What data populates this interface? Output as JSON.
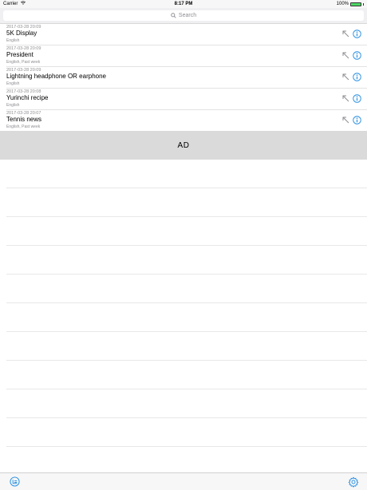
{
  "status": {
    "carrier": "Carrier",
    "time": "8:17 PM",
    "battery": "100%",
    "battery_level": 1.0
  },
  "search": {
    "placeholder": "Search"
  },
  "history": [
    {
      "date": "2017-03-28 20:09",
      "title": "5K Display",
      "sub": "English"
    },
    {
      "date": "2017-03-28 20:09",
      "title": "President",
      "sub": "English, Past week"
    },
    {
      "date": "2017-03-28 20:09",
      "title": "Lightning headphone OR earphone",
      "sub": "English"
    },
    {
      "date": "2017-03-28 20:08",
      "title": "Yurinchi recipe",
      "sub": "English"
    },
    {
      "date": "2017-03-28 20:07",
      "title": "Tennis news",
      "sub": "English, Past week"
    }
  ],
  "ad": {
    "label": "AD"
  },
  "colors": {
    "accent": "#1f8ae0",
    "battery": "#4cd964",
    "ad_background": "#dadada"
  }
}
